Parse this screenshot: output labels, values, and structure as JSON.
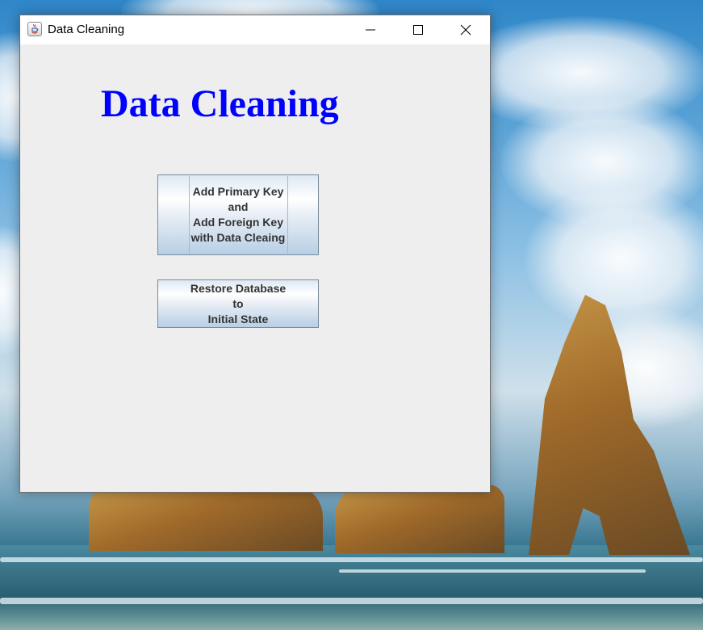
{
  "window": {
    "title": "Data Cleaning"
  },
  "main": {
    "heading": "Data Cleaning",
    "buttons": [
      {
        "lines": [
          "Add Primary Key",
          "and",
          "Add Foreign Key",
          "with Data Cleaing"
        ]
      },
      {
        "lines": [
          "Restore Database",
          "to",
          "Initial State"
        ]
      }
    ]
  },
  "colors": {
    "heading": "#0000ff",
    "window_bg": "#eeeeee",
    "button_text": "#333333"
  },
  "icons": {
    "app": "java-icon",
    "minimize": "minimize-icon",
    "maximize": "maximize-icon",
    "close": "close-icon"
  }
}
